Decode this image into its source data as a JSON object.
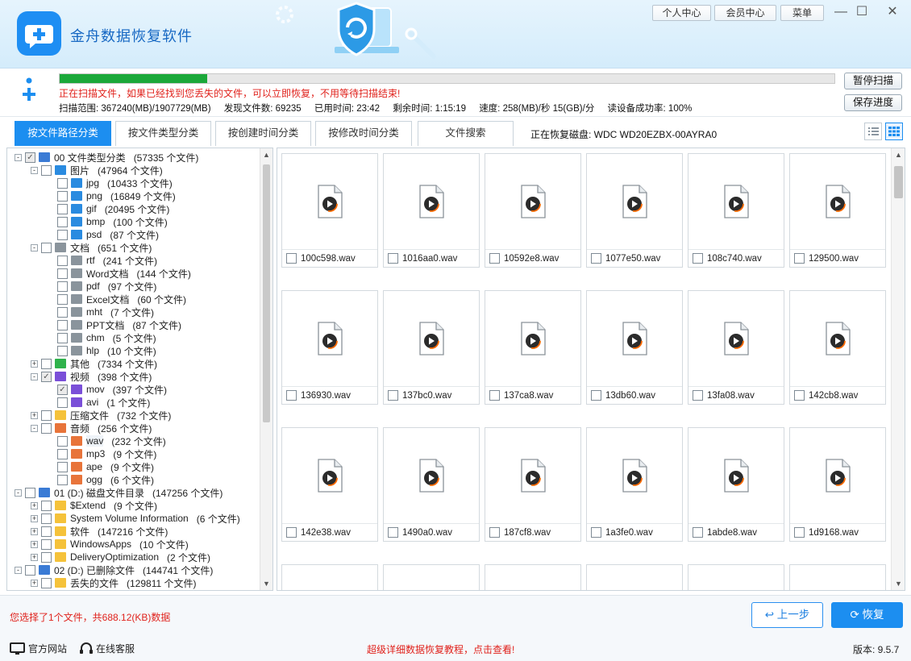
{
  "app": {
    "title": "金舟数据恢复软件",
    "accent": "#1c8ef0"
  },
  "topbar": {
    "personal": "个人中心",
    "member": "会员中心",
    "menu": "菜单"
  },
  "scan": {
    "progress": 0.19,
    "message": "正在扫描文件，如果已经找到您丢失的文件，可以立即恢复，不用等待扫描结束!",
    "range": "扫描范围: 367240(MB)/1907729(MB)",
    "found": "发现文件数: 69235",
    "elapsed": "已用时间: 23:42",
    "remaining": "剩余时间: 1:15:19",
    "speed": "速度: 258(MB)/秒  15(GB)/分",
    "success": "读设备成功率: 100%",
    "pause_label": "暂停扫描",
    "save_label": "保存进度"
  },
  "tabs": [
    "按文件路径分类",
    "按文件类型分类",
    "按创建时间分类",
    "按修改时间分类",
    "文件搜索"
  ],
  "restoring_disk": "正在恢复磁盘: WDC WD20EZBX-00AYRA0",
  "tree": [
    {
      "level": 0,
      "exp": "-",
      "check": "partial",
      "icon": "drive",
      "label": "00 文件类型分类",
      "count": "(57335 个文件)"
    },
    {
      "level": 1,
      "exp": "-",
      "check": "none",
      "icon": "image",
      "label": "图片",
      "count": "(47964 个文件)"
    },
    {
      "level": 2,
      "exp": "",
      "check": "none",
      "icon": "image",
      "label": "jpg",
      "count": "(10433 个文件)"
    },
    {
      "level": 2,
      "exp": "",
      "check": "none",
      "icon": "image",
      "label": "png",
      "count": "(16849 个文件)"
    },
    {
      "level": 2,
      "exp": "",
      "check": "none",
      "icon": "image",
      "label": "gif",
      "count": "(20495 个文件)"
    },
    {
      "level": 2,
      "exp": "",
      "check": "none",
      "icon": "image",
      "label": "bmp",
      "count": "(100 个文件)"
    },
    {
      "level": 2,
      "exp": "",
      "check": "none",
      "icon": "image",
      "label": "psd",
      "count": "(87 个文件)"
    },
    {
      "level": 1,
      "exp": "-",
      "check": "none",
      "icon": "doc",
      "label": "文档",
      "count": "(651 个文件)"
    },
    {
      "level": 2,
      "exp": "",
      "check": "none",
      "icon": "doc",
      "label": "rtf",
      "count": "(241 个文件)"
    },
    {
      "level": 2,
      "exp": "",
      "check": "none",
      "icon": "doc",
      "label": "Word文档",
      "count": "(144 个文件)"
    },
    {
      "level": 2,
      "exp": "",
      "check": "none",
      "icon": "doc",
      "label": "pdf",
      "count": "(97 个文件)"
    },
    {
      "level": 2,
      "exp": "",
      "check": "none",
      "icon": "doc",
      "label": "Excel文档",
      "count": "(60 个文件)"
    },
    {
      "level": 2,
      "exp": "",
      "check": "none",
      "icon": "doc",
      "label": "mht",
      "count": "(7 个文件)"
    },
    {
      "level": 2,
      "exp": "",
      "check": "none",
      "icon": "doc",
      "label": "PPT文档",
      "count": "(87 个文件)"
    },
    {
      "level": 2,
      "exp": "",
      "check": "none",
      "icon": "doc",
      "label": "chm",
      "count": "(5 个文件)"
    },
    {
      "level": 2,
      "exp": "",
      "check": "none",
      "icon": "doc",
      "label": "hlp",
      "count": "(10 个文件)"
    },
    {
      "level": 1,
      "exp": "+",
      "check": "none",
      "icon": "other",
      "label": "其他",
      "count": "(7334 个文件)"
    },
    {
      "level": 1,
      "exp": "-",
      "check": "partial",
      "icon": "video",
      "label": "视频",
      "count": "(398 个文件)"
    },
    {
      "level": 2,
      "exp": "",
      "check": "partial",
      "icon": "video",
      "label": "mov",
      "count": "(397 个文件)"
    },
    {
      "level": 2,
      "exp": "",
      "check": "none",
      "icon": "video",
      "label": "avi",
      "count": "(1 个文件)"
    },
    {
      "level": 1,
      "exp": "+",
      "check": "none",
      "icon": "folder",
      "label": "压缩文件",
      "count": "(732 个文件)"
    },
    {
      "level": 1,
      "exp": "-",
      "check": "none",
      "icon": "audio",
      "label": "音频",
      "count": "(256 个文件)"
    },
    {
      "level": 2,
      "exp": "",
      "check": "none",
      "icon": "audio",
      "label": "wav",
      "count": "(232 个文件)",
      "selected": true
    },
    {
      "level": 2,
      "exp": "",
      "check": "none",
      "icon": "audio",
      "label": "mp3",
      "count": "(9 个文件)"
    },
    {
      "level": 2,
      "exp": "",
      "check": "none",
      "icon": "audio",
      "label": "ape",
      "count": "(9 个文件)"
    },
    {
      "level": 2,
      "exp": "",
      "check": "none",
      "icon": "audio",
      "label": "ogg",
      "count": "(6 个文件)"
    },
    {
      "level": 0,
      "exp": "-",
      "check": "none",
      "icon": "drive",
      "label": "01 (D:) 磁盘文件目录",
      "count": "(147256 个文件)"
    },
    {
      "level": 1,
      "exp": "+",
      "check": "none",
      "icon": "folder",
      "label": "$Extend",
      "count": "(9 个文件)"
    },
    {
      "level": 1,
      "exp": "+",
      "check": "none",
      "icon": "folder",
      "label": "System Volume Information",
      "count": "(6 个文件)"
    },
    {
      "level": 1,
      "exp": "+",
      "check": "none",
      "icon": "folder",
      "label": "软件",
      "count": "(147216 个文件)"
    },
    {
      "level": 1,
      "exp": "+",
      "check": "none",
      "icon": "folder",
      "label": "WindowsApps",
      "count": "(10 个文件)"
    },
    {
      "level": 1,
      "exp": "+",
      "check": "none",
      "icon": "folder",
      "label": "DeliveryOptimization",
      "count": "(2 个文件)"
    },
    {
      "level": 0,
      "exp": "-",
      "check": "none",
      "icon": "drive",
      "label": "02 (D:) 已删除文件",
      "count": "(144741 个文件)"
    },
    {
      "level": 1,
      "exp": "+",
      "check": "none",
      "icon": "folder",
      "label": "丢失的文件",
      "count": "(129811 个文件)"
    }
  ],
  "files": [
    "100c598.wav",
    "1016aa0.wav",
    "10592e8.wav",
    "1077e50.wav",
    "108c740.wav",
    "129500.wav",
    "136930.wav",
    "137bc0.wav",
    "137ca8.wav",
    "13db60.wav",
    "13fa08.wav",
    "142cb8.wav",
    "142e38.wav",
    "1490a0.wav",
    "187cf8.wav",
    "1a3fe0.wav",
    "1abde8.wav",
    "1d9168.wav",
    "",
    "",
    "",
    "",
    "",
    ""
  ],
  "footer": {
    "selection": "您选择了1个文件，共688.12(KB)数据",
    "prev": "上一步",
    "recover": "恢复",
    "website": "官方网站",
    "service": "在线客服",
    "tutorial": "超级详细数据恢复教程，点击查看!",
    "version": "版本: 9.5.7"
  }
}
